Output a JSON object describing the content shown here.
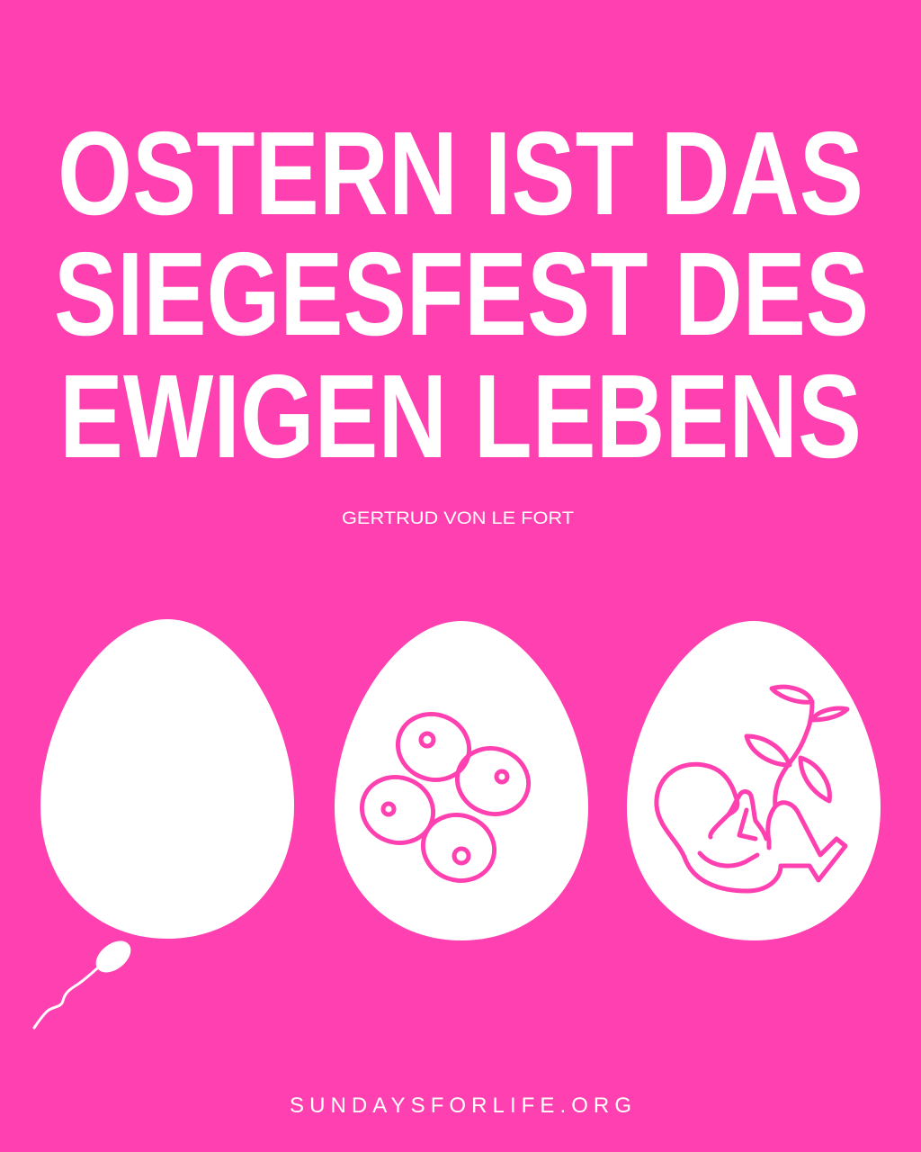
{
  "headline": {
    "line1": "OSTERN IST DAS",
    "line2": "SIEGESFEST DES",
    "line3": "EWIGEN LEBENS"
  },
  "author": "GERTRUD VON LE FORT",
  "footer": {
    "website": "SUNDAYSFORLIFE.ORG"
  },
  "colors": {
    "background": "#FF40B0",
    "foreground": "#FFFFFF"
  },
  "icons": [
    "sperm-icon",
    "egg-icon",
    "cell-division-icon",
    "fetus-with-plant-icon"
  ]
}
